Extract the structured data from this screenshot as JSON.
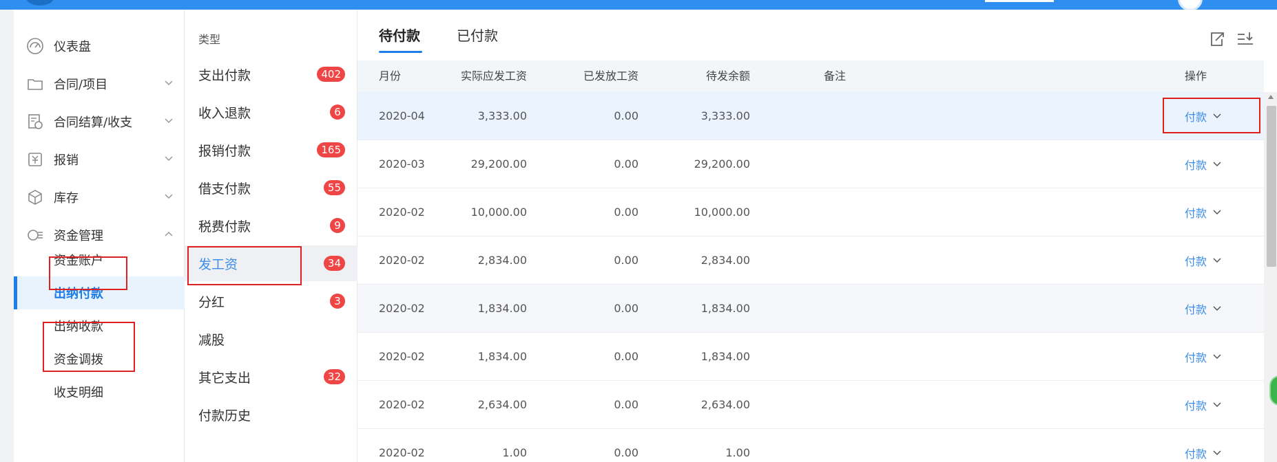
{
  "colors": {
    "accent": "#1d7dea",
    "badge": "#f04545",
    "annotation": "#e02020",
    "topbar": "#2f8ff0"
  },
  "sidebar": {
    "items": [
      {
        "label": "仪表盘",
        "icon": "dashboard-icon"
      },
      {
        "label": "合同/项目",
        "icon": "folder-icon"
      },
      {
        "label": "合同结算/收支",
        "icon": "settlement-icon"
      },
      {
        "label": "报销",
        "icon": "reimbursement-icon"
      },
      {
        "label": "库存",
        "icon": "box-icon"
      },
      {
        "label": "资金管理",
        "icon": "funds-icon"
      }
    ],
    "sub_items": [
      {
        "label": "资金账户"
      },
      {
        "label": "出纳付款",
        "active": true
      },
      {
        "label": "出纳收款"
      },
      {
        "label": "资金调拨"
      },
      {
        "label": "收支明细"
      }
    ]
  },
  "types": {
    "header": "类型",
    "items": [
      {
        "label": "支出付款",
        "badge": "402"
      },
      {
        "label": "收入退款",
        "badge": "6"
      },
      {
        "label": "报销付款",
        "badge": "165"
      },
      {
        "label": "借支付款",
        "badge": "55"
      },
      {
        "label": "税费付款",
        "badge": "9"
      },
      {
        "label": "发工资",
        "badge": "34",
        "active": true
      },
      {
        "label": "分红",
        "badge": "3"
      },
      {
        "label": "减股",
        "badge": ""
      },
      {
        "label": "其它支出",
        "badge": "32"
      },
      {
        "label": "付款历史",
        "badge": ""
      }
    ]
  },
  "tabs": [
    {
      "label": "待付款",
      "active": true
    },
    {
      "label": "已付款"
    }
  ],
  "toolbar": {
    "export_icon": "export-icon",
    "sort_icon": "sort-download-icon"
  },
  "table": {
    "columns": [
      "月份",
      "实际应发工资",
      "已发放工资",
      "待发余额",
      "备注",
      "操作"
    ],
    "action_label": "付款",
    "rows": [
      {
        "month": "2020-04",
        "actual": "3,333.00",
        "paid": "0.00",
        "balance": "3,333.00",
        "note": ""
      },
      {
        "month": "2020-03",
        "actual": "29,200.00",
        "paid": "0.00",
        "balance": "29,200.00",
        "note": ""
      },
      {
        "month": "2020-02",
        "actual": "10,000.00",
        "paid": "0.00",
        "balance": "10,000.00",
        "note": ""
      },
      {
        "month": "2020-02",
        "actual": "2,834.00",
        "paid": "0.00",
        "balance": "2,834.00",
        "note": ""
      },
      {
        "month": "2020-02",
        "actual": "1,834.00",
        "paid": "0.00",
        "balance": "1,834.00",
        "note": ""
      },
      {
        "month": "2020-02",
        "actual": "1,834.00",
        "paid": "0.00",
        "balance": "1,834.00",
        "note": ""
      },
      {
        "month": "2020-02",
        "actual": "2,634.00",
        "paid": "0.00",
        "balance": "2,634.00",
        "note": ""
      },
      {
        "month": "2020-02",
        "actual": "1.00",
        "paid": "0.00",
        "balance": "1.00",
        "note": ""
      }
    ]
  }
}
